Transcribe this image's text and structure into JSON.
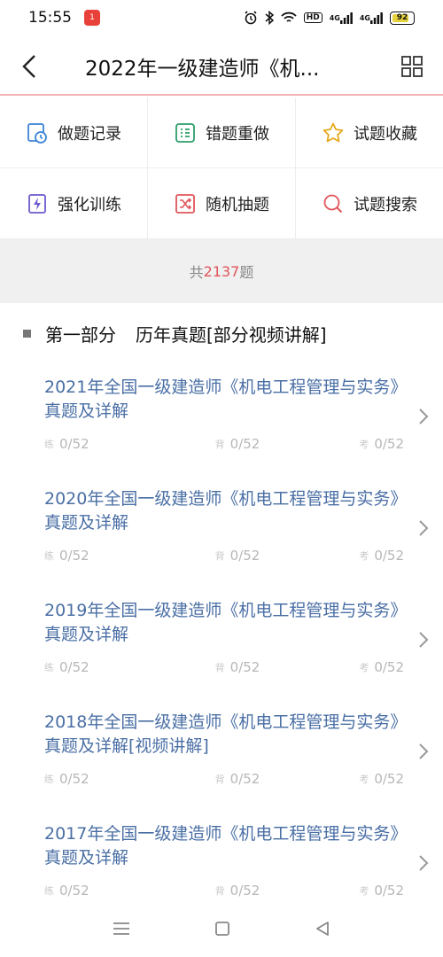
{
  "status": {
    "time": "15:55",
    "notif_label": "1",
    "hd_label": "HD",
    "signal1": "4G",
    "signal2": "4G",
    "battery": "92"
  },
  "header": {
    "title": "2022年一级建造师《机..."
  },
  "functions": [
    {
      "label": "做题记录",
      "icon": "history-icon"
    },
    {
      "label": "错题重做",
      "icon": "redo-list-icon"
    },
    {
      "label": "试题收藏",
      "icon": "star-icon"
    },
    {
      "label": "强化训练",
      "icon": "lightning-icon"
    },
    {
      "label": "随机抽题",
      "icon": "shuffle-icon"
    },
    {
      "label": "试题搜索",
      "icon": "search-icon"
    }
  ],
  "total": {
    "prefix": "共",
    "count": "2137",
    "suffix": "题"
  },
  "section": {
    "part": "第一部分",
    "title": "历年真题[部分视频讲解]"
  },
  "papers": [
    {
      "name": "2021年全国一级建造师《机电工程管理与实务》真题及详解",
      "practice": "0/52",
      "recite": "0/52",
      "exam": "0/52"
    },
    {
      "name": "2020年全国一级建造师《机电工程管理与实务》真题及详解",
      "practice": "0/52",
      "recite": "0/52",
      "exam": "0/52"
    },
    {
      "name": "2019年全国一级建造师《机电工程管理与实务》真题及详解",
      "practice": "0/52",
      "recite": "0/52",
      "exam": "0/52"
    },
    {
      "name": "2018年全国一级建造师《机电工程管理与实务》真题及详解[视频讲解]",
      "practice": "0/52",
      "recite": "0/52",
      "exam": "0/52"
    },
    {
      "name": "2017年全国一级建造师《机电工程管理与实务》真题及详解",
      "practice": "0/52",
      "recite": "0/52",
      "exam": "0/52"
    }
  ],
  "stat_tags": {
    "practice": "练",
    "recite": "背",
    "exam": "考"
  },
  "colors": {
    "accent": "#e0555a",
    "link": "#4a6fa5"
  }
}
